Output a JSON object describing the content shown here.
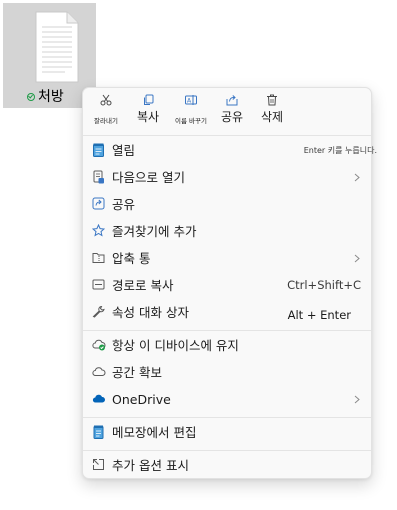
{
  "file": {
    "name": "처방",
    "icon": "text-document-icon",
    "status_icon": "sync-check-icon"
  },
  "quick_actions": [
    {
      "id": "cut",
      "label": "잘라내기",
      "icon": "cut-icon"
    },
    {
      "id": "copy",
      "label": "복사",
      "icon": "copy-icon"
    },
    {
      "id": "rename",
      "label": "이름 바꾸기",
      "icon": "rename-icon"
    },
    {
      "id": "share",
      "label": "공유",
      "icon": "share-icon"
    },
    {
      "id": "delete",
      "label": "삭제",
      "icon": "delete-icon"
    }
  ],
  "menu": [
    {
      "label": "열림",
      "shortcut": "Enter 키를 누릅니다.",
      "icon": "notepad-icon"
    },
    {
      "label": "다음으로 열기",
      "submenu": true,
      "icon": "open-with-icon"
    },
    {
      "label": "공유",
      "icon": "share-icon"
    },
    {
      "label": "즐겨찾기에 추가",
      "icon": "star-icon"
    },
    {
      "label": "압축 통",
      "submenu": true,
      "icon": "zip-folder-icon"
    },
    {
      "label": "경로로 복사",
      "shortcut": "Ctrl+Shift+C",
      "icon": "copy-path-icon"
    },
    {
      "label": "속성 대화 상자",
      "shortcut": "Alt + Enter",
      "icon": "wrench-icon"
    },
    {
      "label": "항상 이 디바이스에 유지",
      "icon": "cloud-keep-icon"
    },
    {
      "label": "공간 확보",
      "icon": "cloud-free-icon"
    },
    {
      "label": "OneDrive",
      "submenu": true,
      "icon": "onedrive-icon"
    },
    {
      "label": "메모장에서 편집",
      "icon": "notepad-icon"
    },
    {
      "label": "추가 옵션 표시",
      "icon": "more-options-icon"
    }
  ],
  "colors": {
    "accent": "#0067c0",
    "onedrive": "#0364b8",
    "sync_green": "#1e9b47",
    "menu_bg": "#f9f9f9"
  }
}
